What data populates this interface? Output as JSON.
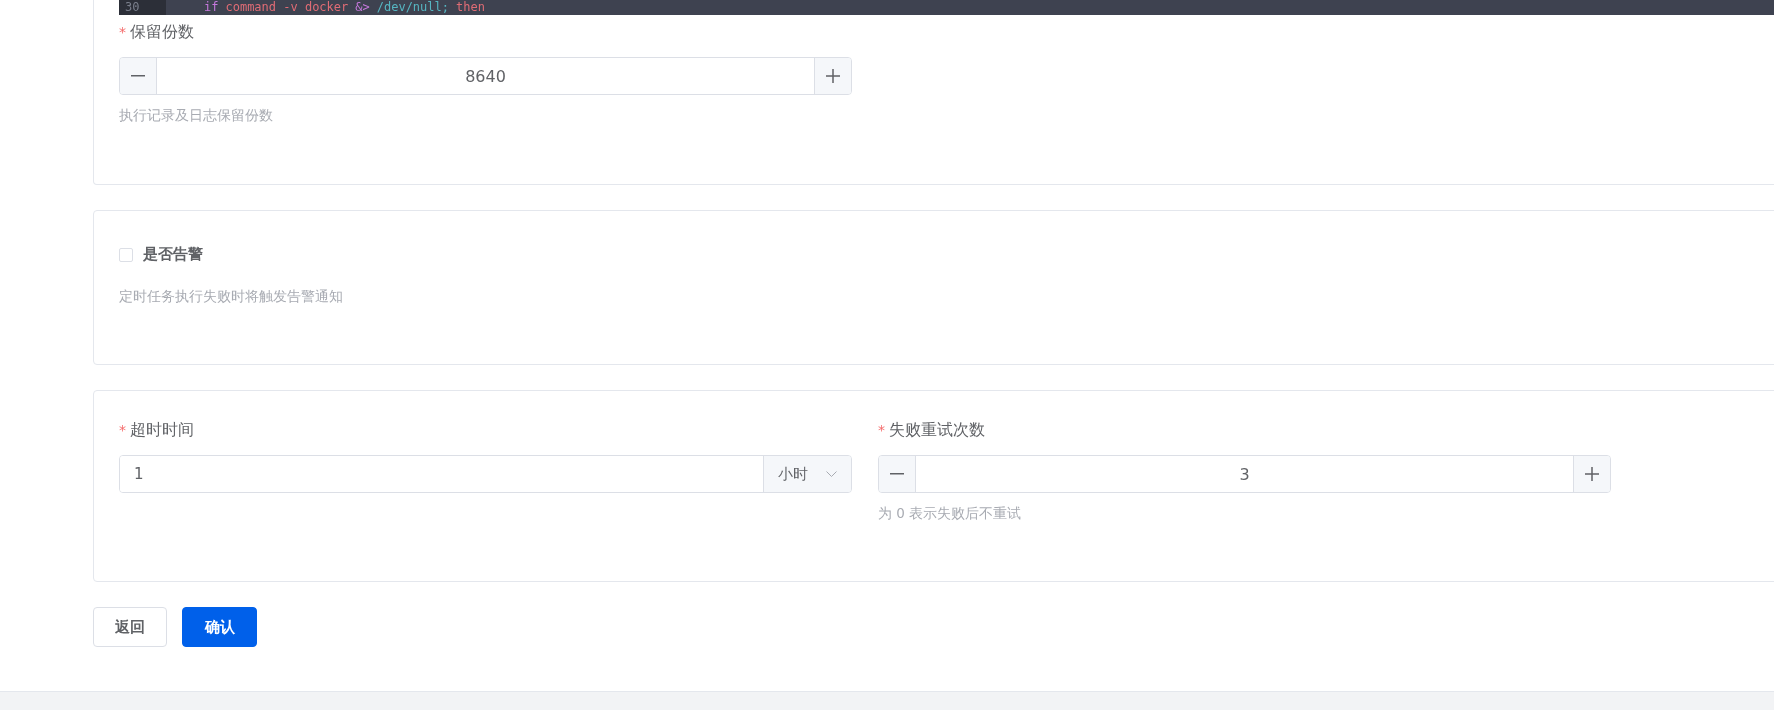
{
  "code_line": {
    "line_number": "30",
    "tokens": [
      {
        "kind": "keyword",
        "text": "if"
      },
      {
        "kind": "command",
        "text": "command -v docker"
      },
      {
        "kind": "operator",
        "text": "&>"
      },
      {
        "kind": "path",
        "text": "/dev/null;"
      },
      {
        "kind": "command",
        "text": "then"
      }
    ]
  },
  "retention": {
    "required_mark": "*",
    "label": "保留份数",
    "value": "8640",
    "hint": "执行记录及日志保留份数"
  },
  "alert": {
    "label": "是否告警",
    "checked": false,
    "hint": "定时任务执行失败时将触发告警通知"
  },
  "timeout": {
    "required_mark": "*",
    "label": "超时时间",
    "value": "1",
    "unit": "小时"
  },
  "retries": {
    "required_mark": "*",
    "label": "失败重试次数",
    "value": "3",
    "hint": "为 0 表示失败后不重试"
  },
  "buttons": [
    {
      "label": "返回",
      "kind": "default"
    },
    {
      "label": "确认",
      "kind": "primary"
    }
  ]
}
